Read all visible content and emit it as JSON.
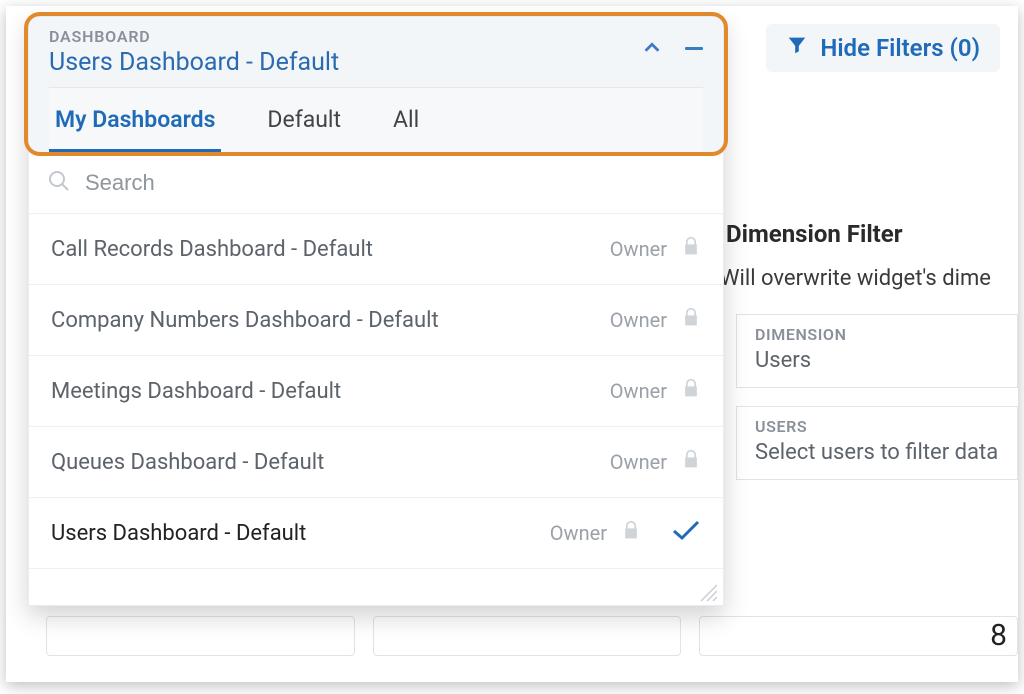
{
  "header": {
    "label": "DASHBOARD",
    "current": "Users Dashboard - Default"
  },
  "tabs": {
    "my": "My Dashboards",
    "default": "Default",
    "all": "All"
  },
  "search": {
    "placeholder": "Search"
  },
  "owner_label": "Owner",
  "items": [
    {
      "name": "Call Records Dashboard - Default"
    },
    {
      "name": "Company Numbers Dashboard - Default"
    },
    {
      "name": "Meetings Dashboard - Default"
    },
    {
      "name": "Queues Dashboard - Default"
    },
    {
      "name": "Users Dashboard - Default"
    }
  ],
  "hide_filters": {
    "label": "Hide Filters (0)"
  },
  "dimension_filter": {
    "title": "Dimension Filter",
    "subtitle": "Will overwrite widget's dime",
    "dimension_label": "DIMENSION",
    "dimension_value": "Users",
    "users_label": "USERS",
    "users_value": "Select users to filter data"
  },
  "bottom_number": "8"
}
